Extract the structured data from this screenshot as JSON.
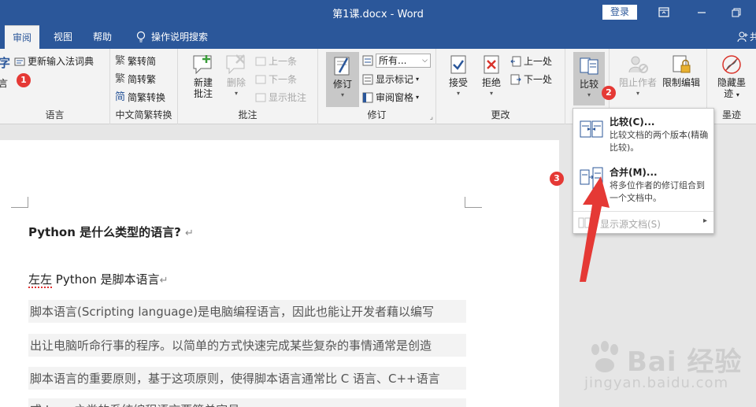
{
  "window": {
    "title": "第1课.docx  -  Word",
    "login_label": "登录"
  },
  "tabs": [
    {
      "label": "审阅",
      "active": true
    },
    {
      "label": "视图"
    },
    {
      "label": "帮助"
    }
  ],
  "tell_me": "操作说明搜索",
  "share_partial": "共",
  "ribbon": {
    "language": {
      "partial_char_top": "字",
      "partial_char_bottom": "言",
      "update_ime": "更新输入法词典",
      "label": "语言"
    },
    "chinese_conv": {
      "to_trad": "繁转简",
      "to_simp": "简转繁",
      "conv": "简繁转换",
      "label": "中文简繁转换"
    },
    "comments": {
      "new": "新建\n批注",
      "new_l1": "新建",
      "new_l2": "批注",
      "delete": "删除",
      "prev": "上一条",
      "next": "下一条",
      "show": "显示批注",
      "label": "批注"
    },
    "tracking": {
      "track": "修订",
      "markup_select": "所有...",
      "show_markup": "显示标记",
      "review_pane": "审阅窗格",
      "label": "修订"
    },
    "changes": {
      "accept": "接受",
      "reject": "拒绝",
      "prev": "上一处",
      "next": "下一处",
      "label": "更改"
    },
    "compare": {
      "compare": "比较"
    },
    "protect": {
      "block_authors": "阻止作者",
      "restrict": "限制编辑"
    },
    "ink": {
      "hide_l1": "隐藏墨",
      "hide_l2": "迹",
      "label": "墨迹"
    }
  },
  "dropdown": {
    "compare_title": "比较(C)...",
    "compare_desc": "比较文档的两个版本(精确比较)。",
    "combine_title": "合并(M)...",
    "combine_desc": "将多位作者的修订组合到一个文档中。",
    "show_source": "显示源文档(S)"
  },
  "document": {
    "heading": "Python  是什么类型的语言?",
    "line1_a": "左左",
    "line1_b": "  Python 是脚本语言",
    "para": [
      "脚本语言(Scripting language)是电脑编程语言，因此也能让开发者藉以编写",
      "出让电脑听命行事的程序。以简单的方式快速完成某些复杂的事情通常是创造",
      "脚本语言的重要原则，基于这项原则，使得脚本语言通常比  C 语言、C++语言",
      "或  Java  之类的系统编程语言要简单容易。"
    ],
    "pilcrow": "↵"
  },
  "badges": [
    "1",
    "2",
    "3"
  ],
  "watermark": {
    "brand": "Bai 经验",
    "url": "jingyan.baidu.com"
  },
  "colors": {
    "accent": "#2b579a",
    "badge": "#e53935"
  }
}
